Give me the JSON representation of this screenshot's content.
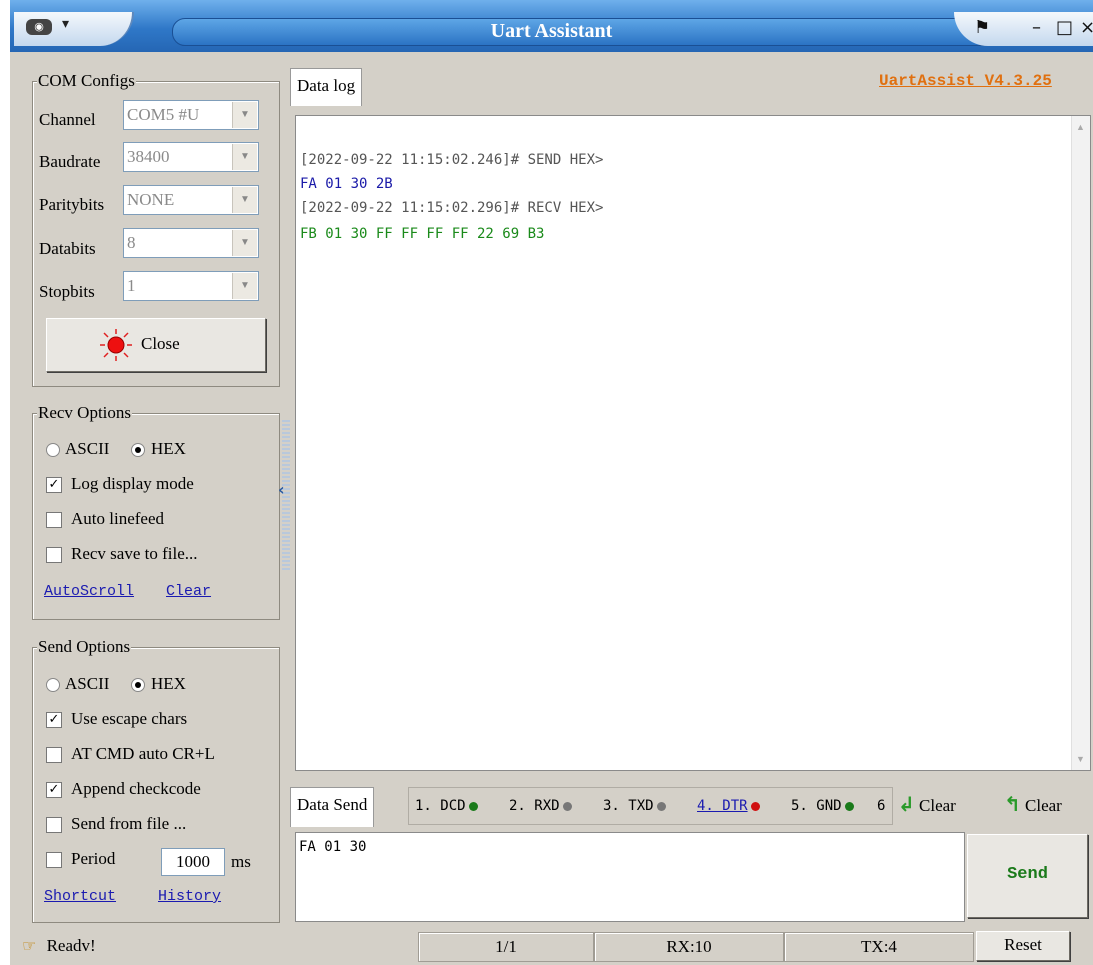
{
  "window": {
    "title": "Uart Assistant",
    "version": "UartAssist V4.3.25",
    "sys_menu_label": "▾"
  },
  "com_configs": {
    "title": "COM Configs",
    "channel_label": "Channel",
    "channel_value": "COM5 #U",
    "baudrate_label": "Baudrate",
    "baudrate_value": "38400",
    "paritybits_label": "Paritybits",
    "paritybits_value": "NONE",
    "databits_label": "Databits",
    "databits_value": "8",
    "stopbits_label": "Stopbits",
    "stopbits_value": "1",
    "close_label": "Close"
  },
  "recv_options": {
    "title": "Recv Options",
    "ascii_label": "ASCII",
    "hex_label": "HEX",
    "selected": "HEX",
    "log_display_label": "Log display mode",
    "log_display_checked": true,
    "auto_linefeed_label": "Auto linefeed",
    "auto_linefeed_checked": false,
    "save_to_file_label": "Recv save to file...",
    "save_to_file_checked": false,
    "autoscroll_link": "AutoScroll",
    "clear_link": "Clear"
  },
  "send_options": {
    "title": "Send Options",
    "ascii_label": "ASCII",
    "hex_label": "HEX",
    "selected": "HEX",
    "escape_label": "Use escape chars",
    "escape_checked": true,
    "at_cmd_label": "AT CMD auto CR+L",
    "at_cmd_checked": false,
    "checkcode_label": "Append checkcode",
    "checkcode_checked": true,
    "from_file_label": "Send from file ...",
    "from_file_checked": false,
    "period_label": "Period",
    "period_checked": false,
    "period_value": "1000",
    "period_unit": "ms",
    "shortcut_link": "Shortcut",
    "history_link": "History"
  },
  "data_log": {
    "tab_label": "Data log",
    "lines": [
      {
        "text": "[2022-09-22 11:15:02.246]# SEND HEX>",
        "color": "#555555"
      },
      {
        "text": "FA 01 30 2B",
        "color": "#1a1aa8"
      },
      {
        "text": "[2022-09-22 11:15:02.296]# RECV HEX>",
        "color": "#555555"
      },
      {
        "text": "FB 01 30 FF FF FF FF 22 69 B3",
        "color": "#1a8a1a"
      }
    ]
  },
  "data_send": {
    "tab_label": "Data Send",
    "pins": [
      {
        "label": "1. DCD",
        "color": "#1a7a1a"
      },
      {
        "label": "2. RXD",
        "color": "#777777"
      },
      {
        "label": "3. TXD",
        "color": "#777777"
      },
      {
        "label": "4. DTR",
        "color": "#d01010"
      },
      {
        "label": "5. GND",
        "color": "#1a7a1a"
      },
      {
        "label": "6",
        "color": ""
      }
    ],
    "clear_recv_label": "Clear",
    "clear_send_label": "Clear",
    "input_value": "FA 01 30",
    "send_label": "Send"
  },
  "status_bar": {
    "ready_text": "Readv!",
    "page": "1/1",
    "rx": "RX:10",
    "tx": "TX:4",
    "reset_label": "Reset"
  },
  "colors": {
    "title_bar": "#2f78c8",
    "version_text": "#e07010",
    "send_button_text": "#1a7a1a",
    "panel_bg": "#d4d0c8"
  }
}
